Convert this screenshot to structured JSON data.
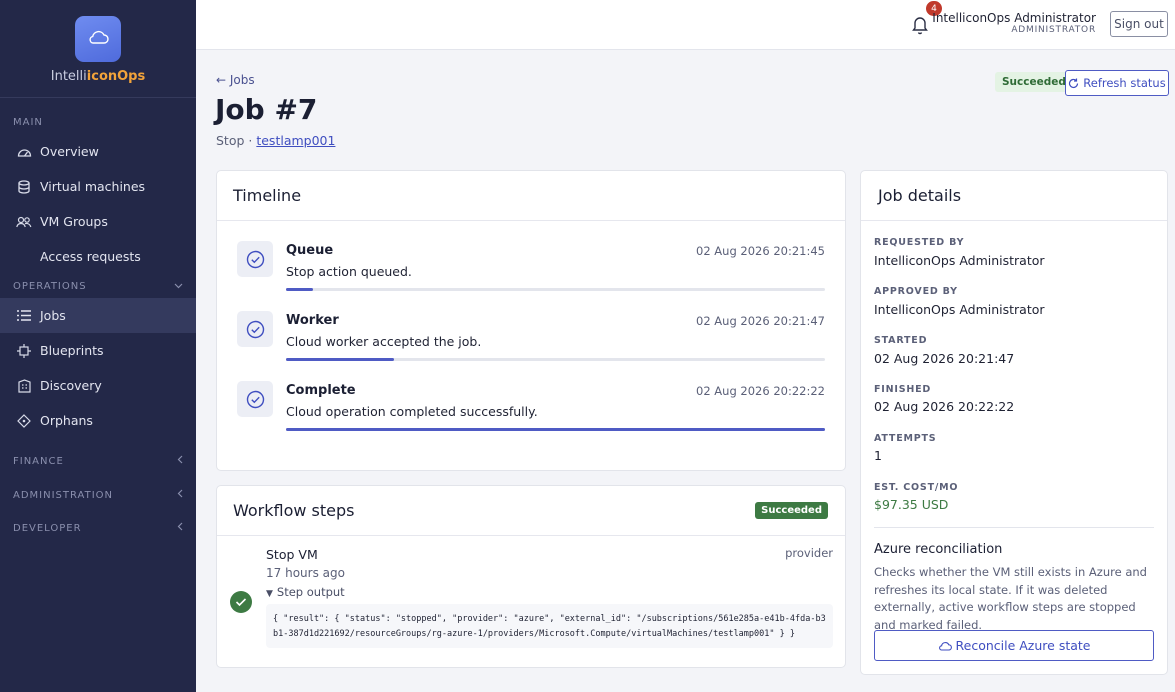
{
  "brand": {
    "name_plain": "Intelli",
    "name_accent": "iconOps",
    "logo_icon": "cloud-icon"
  },
  "sidebar": {
    "main_label": "MAIN",
    "main_items": [
      {
        "label": "Overview",
        "icon": "dashboard-icon"
      },
      {
        "label": "Virtual machines",
        "icon": "database-icon"
      },
      {
        "label": "VM Groups",
        "icon": "users-icon"
      },
      {
        "label": "Access requests",
        "icon": ""
      }
    ],
    "operations_label": "OPERATIONS",
    "operations_items": [
      {
        "label": "Jobs",
        "icon": "list-icon",
        "active": true
      },
      {
        "label": "Blueprints",
        "icon": "blueprint-icon"
      },
      {
        "label": "Discovery",
        "icon": "building-icon"
      },
      {
        "label": "Orphans",
        "icon": "diamond-icon"
      }
    ],
    "finance_label": "FINANCE",
    "administration_label": "ADMINISTRATION",
    "developer_label": "DEVELOPER"
  },
  "topbar": {
    "notification_count": "4",
    "user_name": "IntelliconOps Administrator",
    "user_role": "ADMINISTRATOR",
    "signout_label": "Sign out"
  },
  "header": {
    "back_label": "Jobs",
    "title": "Job #7",
    "action": "Stop",
    "separator": " · ",
    "target": "testlamp001",
    "status": "Succeeded",
    "refresh_label": "Refresh status"
  },
  "timeline": {
    "title": "Timeline",
    "items": [
      {
        "title": "Queue",
        "time": "02 Aug 2026 20:21:45",
        "desc": "Stop action queued.",
        "progress": 0.05
      },
      {
        "title": "Worker",
        "time": "02 Aug 2026 20:21:47",
        "desc": "Cloud worker accepted the job.",
        "progress": 0.2
      },
      {
        "title": "Complete",
        "time": "02 Aug 2026 20:22:22",
        "desc": "Cloud operation completed successfully.",
        "progress": 1.0
      }
    ]
  },
  "workflow": {
    "title": "Workflow steps",
    "status": "Succeeded",
    "step": {
      "name": "Stop VM",
      "time": "17 hours ago",
      "kind": "provider",
      "toggle_label": "Step output",
      "output": "{ \"result\": { \"status\": \"stopped\", \"provider\": \"azure\", \"external_id\": \"/subscriptions/561e285a-e41b-4fda-b3b1-387d1d221692/resourceGroups/rg-azure-1/providers/Microsoft.Compute/virtualMachines/testlamp001\" } }"
    }
  },
  "details": {
    "title": "Job details",
    "requested_by_label": "REQUESTED BY",
    "requested_by": "IntelliconOps Administrator",
    "approved_by_label": "APPROVED BY",
    "approved_by": "IntelliconOps Administrator",
    "started_label": "STARTED",
    "started": "02 Aug 2026 20:21:47",
    "finished_label": "FINISHED",
    "finished": "02 Aug 2026 20:22:22",
    "attempts_label": "ATTEMPTS",
    "attempts": "1",
    "cost_label": "EST. COST/MO",
    "cost": "$97.35 USD",
    "azure_title": "Azure reconciliation",
    "azure_desc": "Checks whether the VM still exists in Azure and refreshes its local state. If it was deleted externally, active workflow steps are stopped and marked failed.",
    "reconcile_label": "Reconcile Azure state"
  },
  "colors": {
    "sidebar_bg": "#232848",
    "accent": "#4f5bc4",
    "success": "#3d7a43",
    "brand_accent": "#f2a33a"
  }
}
